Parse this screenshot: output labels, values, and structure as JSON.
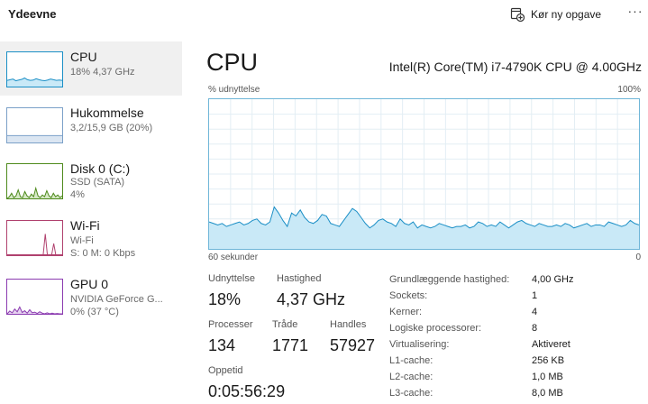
{
  "header": {
    "title": "Ydeevne",
    "run_task_label": "Kør ny opgave",
    "run_task_icon": "run-task-icon",
    "more_label": "···"
  },
  "colors": {
    "cpu": "#1b8fc6",
    "memory": "#7ba0c8",
    "disk": "#4e8a1c",
    "wifi": "#b0416e",
    "gpu": "#8b3bb0",
    "graph_fill": "#c9e9f7",
    "graph_line": "#1b8fc6"
  },
  "sidebar": {
    "items": [
      {
        "name": "CPU",
        "sub": "18% 4,37 GHz",
        "selected": true,
        "history": [
          18,
          20,
          22,
          17,
          19,
          21,
          25,
          20,
          18,
          19,
          23,
          20,
          18,
          17,
          19,
          22,
          20,
          18,
          19,
          18
        ]
      },
      {
        "name": "Hukommelse",
        "sub": "3,2/15,9 GB (20%)",
        "selected": false,
        "fill_fraction": 0.2
      },
      {
        "name": "Disk 0 (C:)",
        "sub1": "SSD (SATA)",
        "sub2": "4%",
        "selected": false,
        "history": [
          0,
          2,
          6,
          1,
          3,
          10,
          2,
          1,
          8,
          3,
          1,
          5,
          2,
          12,
          3,
          1,
          4,
          2,
          9,
          3,
          1,
          6,
          2,
          4,
          1,
          3
        ]
      },
      {
        "name": "Wi-Fi",
        "sub1": "Wi-Fi",
        "sub2": "S: 0 M: 0 Kbps",
        "selected": false,
        "history": [
          0,
          0,
          0,
          0,
          0,
          0,
          0,
          0,
          0,
          0,
          0,
          0,
          0,
          0,
          0,
          0,
          0,
          0,
          62,
          0,
          0,
          0,
          34,
          0,
          0,
          0,
          0
        ]
      },
      {
        "name": "GPU 0",
        "sub1": "NVIDIA GeForce G...",
        "sub2": "0% (37 °C)",
        "selected": false,
        "history": [
          0,
          8,
          3,
          14,
          6,
          20,
          4,
          9,
          2,
          12,
          3,
          5,
          1,
          6,
          2,
          0,
          3,
          0,
          2,
          0,
          1,
          0,
          0
        ]
      }
    ]
  },
  "main": {
    "title": "CPU",
    "model": "Intel(R) Core(TM) i7-4790K CPU @ 4.00GHz",
    "util_label": "% udnyttelse",
    "util_max": "100%",
    "time_left": "60 sekunder",
    "time_right": "0",
    "stats": {
      "utilization": {
        "label": "Udnyttelse",
        "value": "18%"
      },
      "speed": {
        "label": "Hastighed",
        "value": "4,37 GHz"
      },
      "processes": {
        "label": "Processer",
        "value": "134"
      },
      "threads": {
        "label": "Tråde",
        "value": "1771"
      },
      "handles": {
        "label": "Handles",
        "value": "57927"
      },
      "uptime": {
        "label": "Oppetid",
        "value": "0:05:56:29"
      }
    },
    "specs": [
      {
        "label": "Grundlæggende hastighed:",
        "value": "4,00 GHz"
      },
      {
        "label": "Sockets:",
        "value": "1"
      },
      {
        "label": "Kerner:",
        "value": "4"
      },
      {
        "label": "Logiske processorer:",
        "value": "8"
      },
      {
        "label": "Virtualisering:",
        "value": "Aktiveret"
      },
      {
        "label": "L1-cache:",
        "value": "256 KB"
      },
      {
        "label": "L2-cache:",
        "value": "1,0 MB"
      },
      {
        "label": "L3-cache:",
        "value": "8,0 MB"
      }
    ]
  },
  "chart_data": {
    "type": "area",
    "title": "",
    "xlabel": "",
    "ylabel": "% udnyttelse",
    "ylim": [
      0,
      100
    ],
    "xlim": [
      60,
      0
    ],
    "grid": true,
    "series": [
      {
        "values": [
          18,
          17,
          16,
          17,
          15,
          16,
          17,
          18,
          16,
          17,
          19,
          20,
          17,
          16,
          18,
          28,
          24,
          19,
          15,
          24,
          22,
          26,
          21,
          18,
          17,
          19,
          23,
          22,
          17,
          16,
          15,
          19,
          23,
          27,
          25,
          21,
          17,
          14,
          16,
          19,
          20,
          18,
          17,
          15,
          20,
          17,
          16,
          18,
          14,
          16,
          15,
          14,
          15,
          17,
          16,
          15,
          14,
          15,
          15,
          16,
          14,
          15,
          18,
          17,
          15,
          16,
          15,
          18,
          16,
          14,
          16,
          18,
          19,
          17,
          16,
          15,
          17,
          16,
          15,
          15,
          16,
          15,
          17,
          16,
          14,
          15,
          16,
          17,
          15,
          16,
          16,
          15,
          18,
          17,
          16,
          15,
          16,
          19,
          17,
          16
        ]
      }
    ]
  }
}
